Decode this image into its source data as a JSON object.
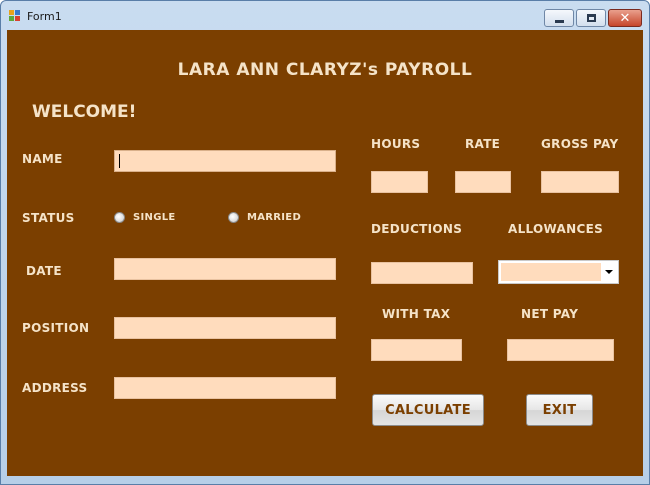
{
  "window": {
    "title": "Form1"
  },
  "form": {
    "heading": "LARA ANN CLARYZ's PAYROLL",
    "welcome": "WELCOME!",
    "labels": {
      "name": "NAME",
      "status": "STATUS",
      "date": "DATE",
      "position": "POSITION",
      "address": "ADDRESS",
      "hours": "HOURS",
      "rate": "RATE",
      "gross_pay": "GROSS PAY",
      "deductions": "DEDUCTIONS",
      "allowances": "ALLOWANCES",
      "with_tax": "WITH TAX",
      "net_pay": "NET PAY"
    },
    "status_options": [
      "SINGLE",
      "MARRIED"
    ],
    "fields": {
      "name": "",
      "date": "",
      "position": "",
      "address": "",
      "hours": "",
      "rate": "",
      "gross_pay": "",
      "deductions": "",
      "allowances": "",
      "with_tax": "",
      "net_pay": ""
    },
    "buttons": {
      "calculate": "CALCULATE",
      "exit": "EXIT"
    }
  },
  "colors": {
    "background": "#7b3f00",
    "text": "#f5e3c8",
    "field": "#ffdcbd"
  }
}
